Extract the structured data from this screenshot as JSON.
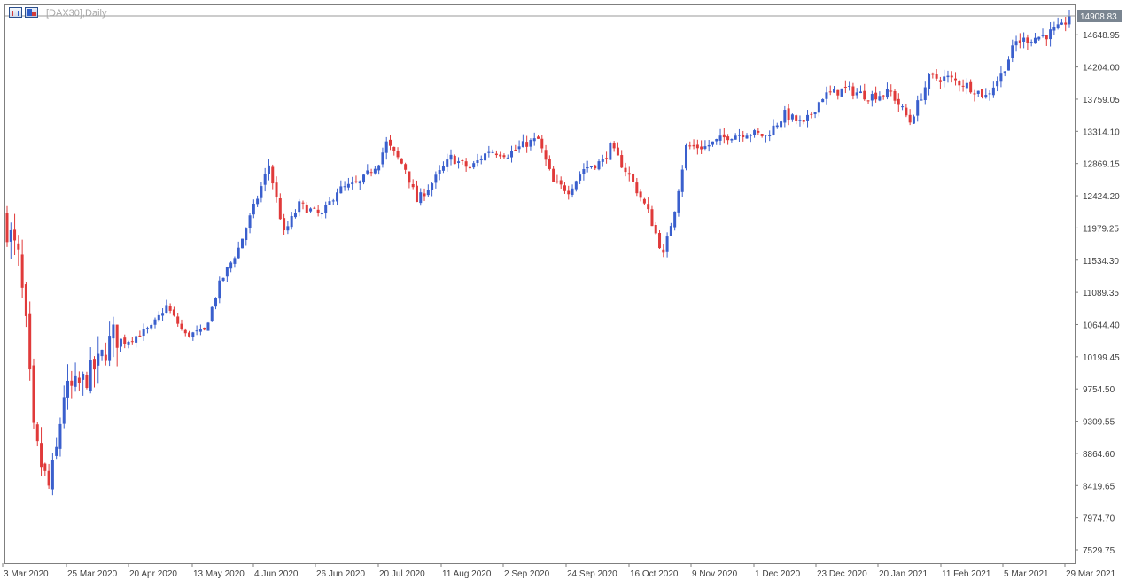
{
  "window": {
    "title": "[DAX30],Daily"
  },
  "icons": [
    "window-list-icon",
    "chart-type-icon"
  ],
  "colors": {
    "bull": "#3a5fcd",
    "bear": "#e03a3a",
    "axis": "#7f7f7f",
    "text": "#404040",
    "price_tag_bg": "#7a8591",
    "price_tag_text": "#ffffff"
  },
  "chart_data": {
    "type": "candlestick",
    "title": "[DAX30],Daily",
    "symbol": "DAX30",
    "timeframe": "Daily",
    "last_price": "14908.83",
    "y_ticks": [
      "14648.95",
      "14204.00",
      "13759.05",
      "13314.10",
      "12869.15",
      "12424.20",
      "11979.25",
      "11534.30",
      "11089.35",
      "10644.40",
      "10199.45",
      "9754.50",
      "9309.55",
      "8864.60",
      "8419.65",
      "7974.70",
      "7529.75"
    ],
    "x_labels": [
      "3 Mar 2020",
      "25 Mar 2020",
      "20 Apr 2020",
      "13 May 2020",
      "4 Jun 2020",
      "26 Jun 2020",
      "20 Jul 2020",
      "11 Aug 2020",
      "2 Sep 2020",
      "24 Sep 2020",
      "16 Oct 2020",
      "9 Nov 2020",
      "1 Dec 2020",
      "23 Dec 2020",
      "20 Jan 2021",
      "11 Feb 2021",
      "5 Mar 2021",
      "29 Mar 2021"
    ],
    "ylim": [
      7200,
      15100
    ],
    "grid": false,
    "anchors": [
      [
        "2020-03-03",
        12000
      ],
      [
        "2020-03-06",
        11550
      ],
      [
        "2020-03-10",
        10600
      ],
      [
        "2020-03-12",
        9150
      ],
      [
        "2020-03-16",
        8700
      ],
      [
        "2020-03-18",
        8400
      ],
      [
        "2020-03-20",
        8900
      ],
      [
        "2020-03-24",
        9700
      ],
      [
        "2020-03-30",
        9800
      ],
      [
        "2020-04-06",
        10100
      ],
      [
        "2020-04-10",
        10500
      ],
      [
        "2020-04-15",
        10400
      ],
      [
        "2020-04-24",
        10600
      ],
      [
        "2020-04-30",
        10900
      ],
      [
        "2020-05-07",
        10500
      ],
      [
        "2020-05-14",
        10550
      ],
      [
        "2020-05-20",
        11200
      ],
      [
        "2020-05-27",
        11700
      ],
      [
        "2020-06-03",
        12400
      ],
      [
        "2020-06-08",
        12850
      ],
      [
        "2020-06-12",
        11900
      ],
      [
        "2020-06-18",
        12300
      ],
      [
        "2020-06-26",
        12150
      ],
      [
        "2020-07-02",
        12500
      ],
      [
        "2020-07-10",
        12600
      ],
      [
        "2020-07-17",
        12900
      ],
      [
        "2020-07-21",
        13150
      ],
      [
        "2020-07-28",
        12800
      ],
      [
        "2020-07-31",
        12350
      ],
      [
        "2020-08-06",
        12600
      ],
      [
        "2020-08-13",
        12950
      ],
      [
        "2020-08-20",
        12800
      ],
      [
        "2020-08-27",
        13050
      ],
      [
        "2020-09-03",
        13000
      ],
      [
        "2020-09-10",
        13150
      ],
      [
        "2020-09-15",
        13200
      ],
      [
        "2020-09-21",
        12600
      ],
      [
        "2020-09-25",
        12500
      ],
      [
        "2020-10-01",
        12800
      ],
      [
        "2020-10-08",
        12900
      ],
      [
        "2020-10-12",
        13100
      ],
      [
        "2020-10-19",
        12700
      ],
      [
        "2020-10-26",
        12200
      ],
      [
        "2020-10-30",
        11600
      ],
      [
        "2020-11-04",
        12250
      ],
      [
        "2020-11-09",
        13100
      ],
      [
        "2020-11-16",
        13100
      ],
      [
        "2020-11-24",
        13250
      ],
      [
        "2020-12-01",
        13300
      ],
      [
        "2020-12-08",
        13250
      ],
      [
        "2020-12-15",
        13550
      ],
      [
        "2020-12-22",
        13400
      ],
      [
        "2020-12-29",
        13800
      ],
      [
        "2021-01-06",
        13900
      ],
      [
        "2021-01-14",
        13800
      ],
      [
        "2021-01-22",
        13850
      ],
      [
        "2021-01-29",
        13450
      ],
      [
        "2021-02-05",
        14050
      ],
      [
        "2021-02-12",
        14050
      ],
      [
        "2021-02-19",
        13950
      ],
      [
        "2021-02-26",
        13800
      ],
      [
        "2021-03-04",
        14100
      ],
      [
        "2021-03-10",
        14550
      ],
      [
        "2021-03-16",
        14600
      ],
      [
        "2021-03-22",
        14650
      ],
      [
        "2021-03-26",
        14750
      ],
      [
        "2021-03-30",
        14908.83
      ]
    ]
  }
}
